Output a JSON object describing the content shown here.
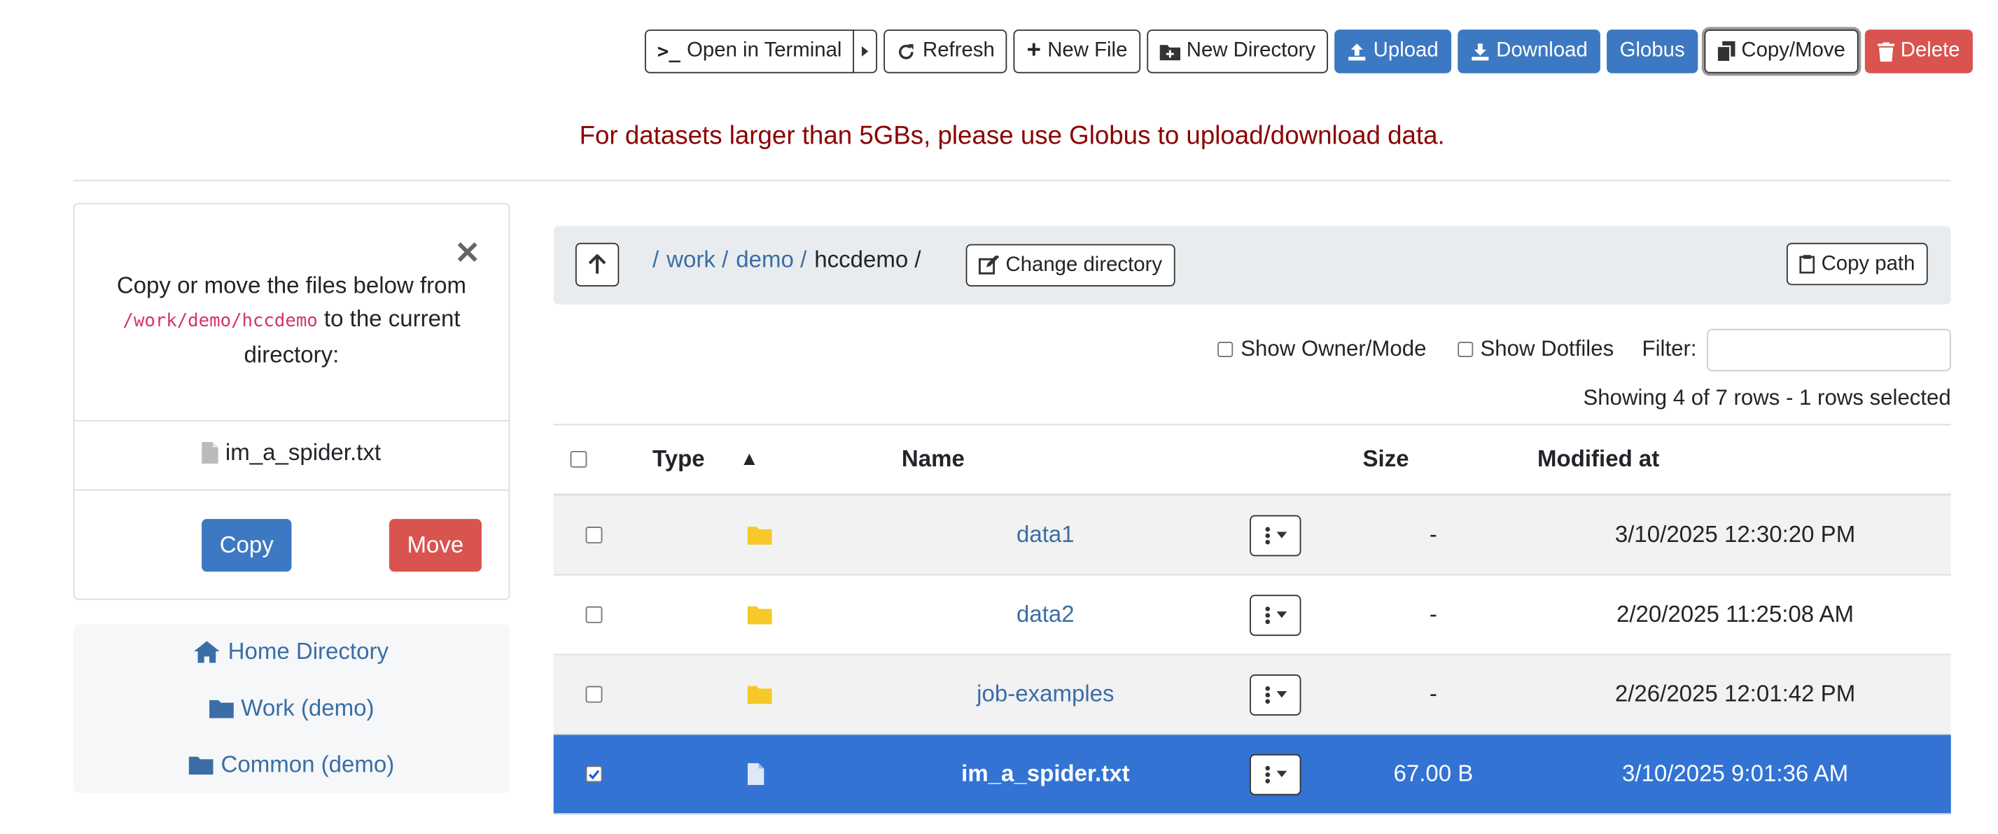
{
  "toolbar": {
    "open_terminal": "Open in Terminal",
    "refresh": "Refresh",
    "new_file": "New File",
    "new_directory": "New Directory",
    "upload": "Upload",
    "download": "Download",
    "globus": "Globus",
    "copy_move": "Copy/Move",
    "delete": "Delete"
  },
  "notice": "For datasets larger than 5GBs, please use Globus to upload/download data.",
  "copy_panel": {
    "message_before": "Copy or move the files below from ",
    "path": "/work/demo/hccdemo",
    "message_after": " to the current directory:",
    "file": "im_a_spider.txt",
    "copy_label": "Copy",
    "move_label": "Move"
  },
  "shortcuts": [
    {
      "label": "Home Directory",
      "icon": "home-icon"
    },
    {
      "label": "Work (demo)",
      "icon": "folder-icon"
    },
    {
      "label": "Common (demo)",
      "icon": "folder-icon"
    }
  ],
  "breadcrumb": {
    "sep": "/",
    "work": "work /",
    "demo": "demo /",
    "current": "hccdemo /",
    "change_dir": "Change directory",
    "copy_path": "Copy path"
  },
  "controls": {
    "show_owner": "Show Owner/Mode",
    "show_dotfiles": "Show Dotfiles",
    "filter_label": "Filter:",
    "row_count": "Showing 4 of 7 rows - 1 rows selected"
  },
  "table": {
    "headers": {
      "type": "Type",
      "sort": "▲",
      "name": "Name",
      "size": "Size",
      "modified": "Modified at"
    },
    "rows": [
      {
        "type": "folder",
        "name": "data1",
        "size": "-",
        "modified": "3/10/2025 12:30:20 PM",
        "selected": false
      },
      {
        "type": "folder",
        "name": "data2",
        "size": "-",
        "modified": "2/20/2025 11:25:08 AM",
        "selected": false
      },
      {
        "type": "folder",
        "name": "job-examples",
        "size": "-",
        "modified": "2/26/2025 12:01:42 PM",
        "selected": false
      },
      {
        "type": "file",
        "name": "im_a_spider.txt",
        "size": "67.00 B",
        "modified": "3/10/2025 9:01:36 AM",
        "selected": true
      }
    ]
  },
  "colors": {
    "primary": "#3d79c2",
    "danger": "#d9534f",
    "notice": "#8b0000",
    "selected_row": "#3273d3",
    "folder": "#f6c829"
  }
}
